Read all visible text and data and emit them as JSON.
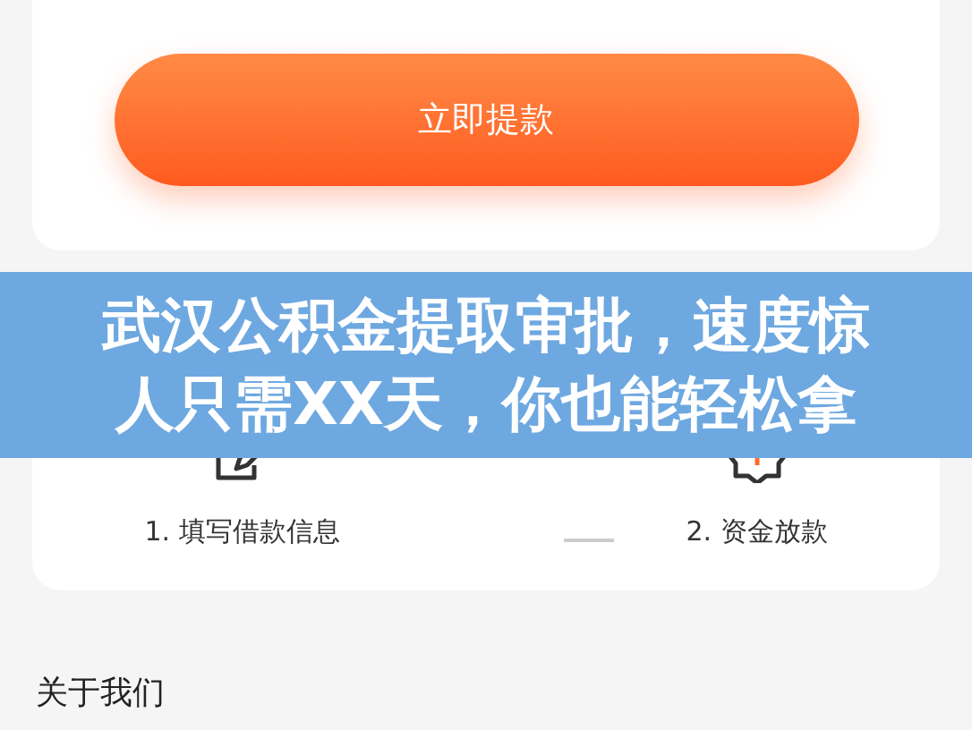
{
  "withdraw_button": {
    "label": "立即提款"
  },
  "steps": [
    {
      "label": "1. 填写借款信息",
      "kind": "form"
    },
    {
      "label": "2. 资金放款",
      "kind": "money"
    }
  ],
  "section_title": "关于我们",
  "banner": {
    "lines": [
      "武汉公积金提取审批，速度惊",
      "人只需XX天，你也能轻松拿"
    ]
  }
}
